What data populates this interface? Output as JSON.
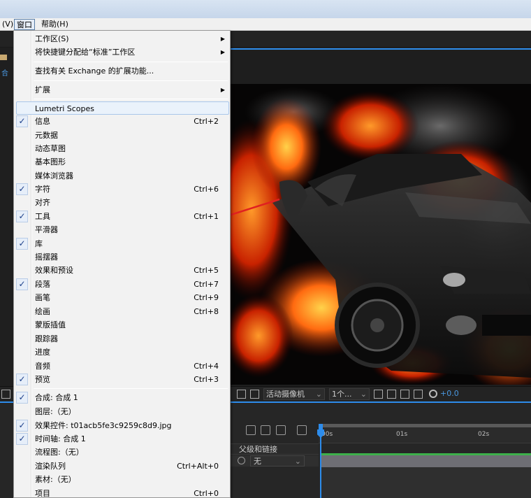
{
  "menubar": {
    "view": "(V)",
    "window": "窗口",
    "help": "帮助(H)"
  },
  "workspace": {
    "left_label": "合",
    "camera": "活动摄像机",
    "views": "1个...",
    "exposure": "+0.0"
  },
  "timeline": {
    "column_header": "父级和链接",
    "parent_value": "无",
    "ticks": [
      "00s",
      "01s",
      "02s"
    ]
  },
  "menu": {
    "items": [
      {
        "label": "工作区(S)",
        "submenu": true,
        "checked": false,
        "shortcut": ""
      },
      {
        "label": "将快捷键分配给“标准”工作区",
        "submenu": true,
        "checked": false,
        "shortcut": ""
      },
      {
        "label": "查找有关 Exchange 的扩展功能...",
        "submenu": false,
        "checked": false,
        "shortcut": ""
      },
      {
        "label": "扩展",
        "submenu": true,
        "checked": false,
        "shortcut": ""
      },
      {
        "label": "Lumetri Scopes",
        "submenu": false,
        "checked": false,
        "shortcut": "",
        "highlighted": true
      },
      {
        "label": "信息",
        "checked": true,
        "shortcut": "Ctrl+2"
      },
      {
        "label": "元数据",
        "checked": false,
        "shortcut": ""
      },
      {
        "label": "动态草图",
        "checked": false,
        "shortcut": ""
      },
      {
        "label": "基本图形",
        "checked": false,
        "shortcut": ""
      },
      {
        "label": "媒体浏览器",
        "checked": false,
        "shortcut": ""
      },
      {
        "label": "字符",
        "checked": true,
        "shortcut": "Ctrl+6"
      },
      {
        "label": "对齐",
        "checked": false,
        "shortcut": ""
      },
      {
        "label": "工具",
        "checked": true,
        "shortcut": "Ctrl+1"
      },
      {
        "label": "平滑器",
        "checked": false,
        "shortcut": ""
      },
      {
        "label": "库",
        "checked": true,
        "shortcut": ""
      },
      {
        "label": "摇摆器",
        "checked": false,
        "shortcut": ""
      },
      {
        "label": "效果和预设",
        "checked": false,
        "shortcut": "Ctrl+5"
      },
      {
        "label": "段落",
        "checked": true,
        "shortcut": "Ctrl+7"
      },
      {
        "label": "画笔",
        "checked": false,
        "shortcut": "Ctrl+9"
      },
      {
        "label": "绘画",
        "checked": false,
        "shortcut": "Ctrl+8"
      },
      {
        "label": "蒙版插值",
        "checked": false,
        "shortcut": ""
      },
      {
        "label": "跟踪器",
        "checked": false,
        "shortcut": ""
      },
      {
        "label": "进度",
        "checked": false,
        "shortcut": ""
      },
      {
        "label": "音频",
        "checked": false,
        "shortcut": "Ctrl+4"
      },
      {
        "label": "预览",
        "checked": true,
        "shortcut": "Ctrl+3"
      },
      {
        "label": "合成: 合成 1",
        "checked": true,
        "shortcut": ""
      },
      {
        "label": "图层:（无）",
        "checked": false,
        "shortcut": ""
      },
      {
        "label": "效果控件: t01acb5fe3c9259c8d9.jpg",
        "checked": true,
        "shortcut": ""
      },
      {
        "label": "时间轴: 合成 1",
        "checked": true,
        "shortcut": ""
      },
      {
        "label": "流程图:（无）",
        "checked": false,
        "shortcut": ""
      },
      {
        "label": "渲染队列",
        "checked": false,
        "shortcut": "Ctrl+Alt+0"
      },
      {
        "label": "素材:（无）",
        "checked": false,
        "shortcut": ""
      },
      {
        "label": "项目",
        "checked": false,
        "shortcut": "Ctrl+0"
      }
    ]
  },
  "colors": {
    "accent": "#2d8ceb",
    "annotation_arrow": "#e02020",
    "check": "#1c3f8a"
  }
}
